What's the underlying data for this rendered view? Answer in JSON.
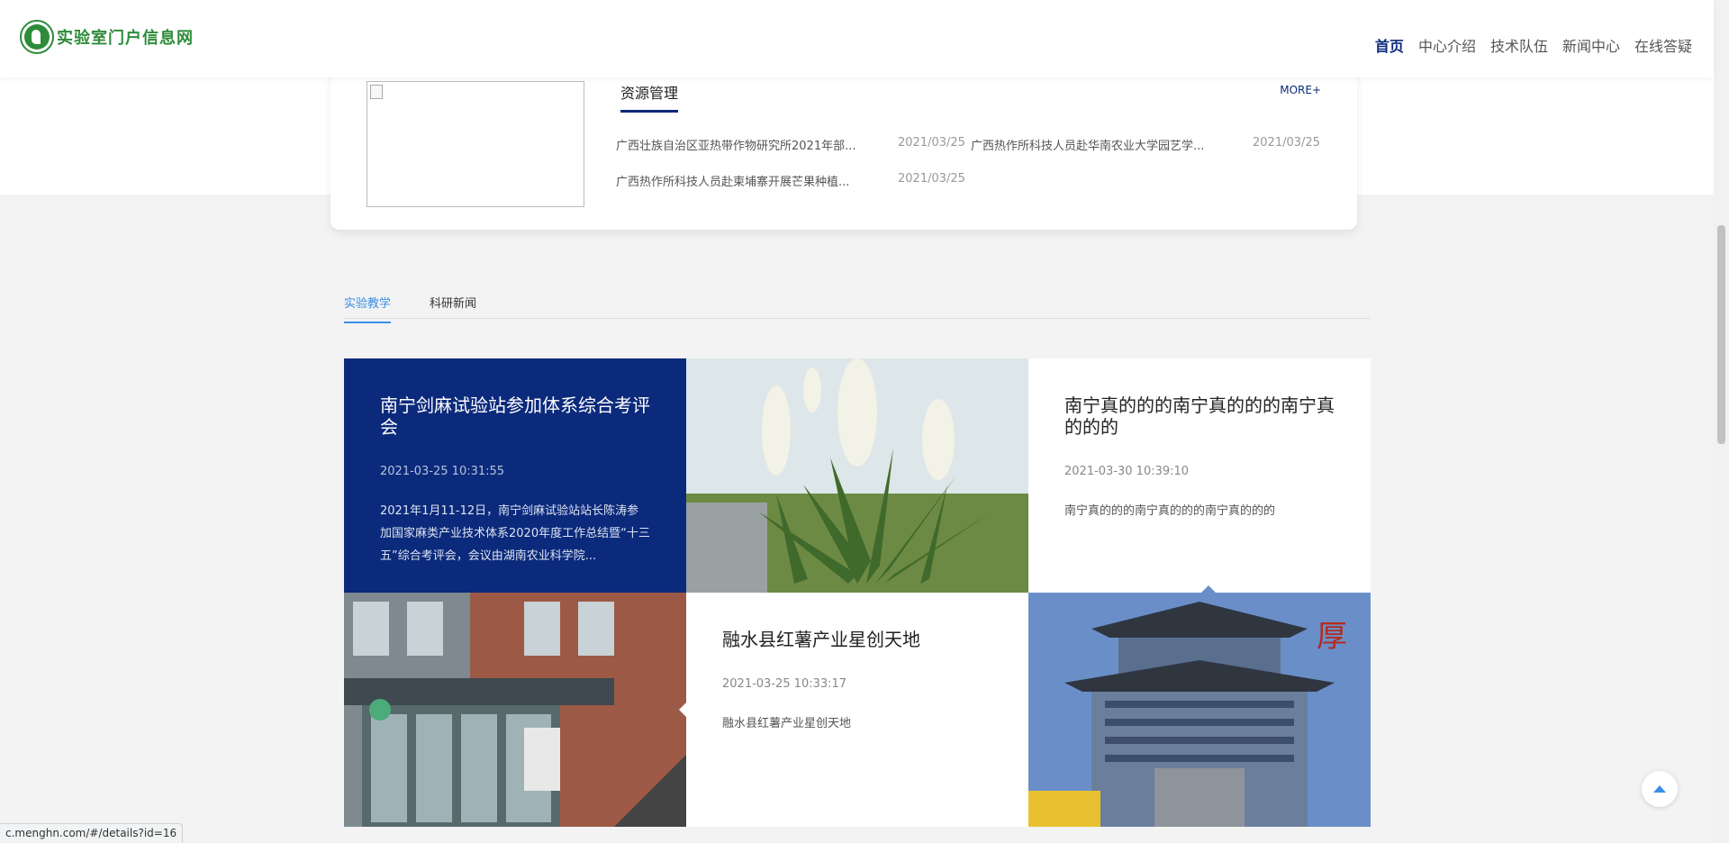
{
  "header": {
    "logo_text": "实验室门户信息网",
    "nav": [
      "首页",
      "中心介绍",
      "技术队伍",
      "新闻中心",
      "在线答疑"
    ],
    "active_nav": "首页"
  },
  "resources": {
    "title": "资源管理",
    "more": "MORE+",
    "items": [
      {
        "text": "广西壮族自治区亚热带作物研究所2021年部...",
        "date": "2021/03/25"
      },
      {
        "text": "广西热作所科技人员赴华南农业大学园艺学...",
        "date": "2021/03/25"
      },
      {
        "text": "广西热作所科技人员赴柬埔寨开展芒果种植...",
        "date": "2021/03/25"
      }
    ]
  },
  "tabs": [
    "实验教学",
    "科研新闻"
  ],
  "active_tab": "实验教学",
  "news": [
    {
      "title": "南宁剑麻试验站参加体系综合考评会",
      "date": "2021-03-25 10:31:55",
      "summary": "2021年1月11-12日，南宁剑麻试验站站长陈涛参加国家麻类产业技术体系2020年度工作总结暨“十三五”综合考评会，会议由湖南农业科学院..."
    },
    {
      "title": "南宁真的的的南宁真的的的南宁真的的的",
      "date": "2021-03-30 10:39:10",
      "summary": "南宁真的的的南宁真的的的南宁真的的的"
    },
    {
      "title": "融水县红薯产业星创天地",
      "date": "2021-03-25 10:33:17",
      "summary": "融水县红薯产业星创天地"
    }
  ],
  "status_url": "c.menghn.com/#/details?id=16",
  "colors": {
    "primary": "#0b2a7b",
    "accent": "#3a8ee6",
    "brand_green": "#2e8b3a"
  }
}
